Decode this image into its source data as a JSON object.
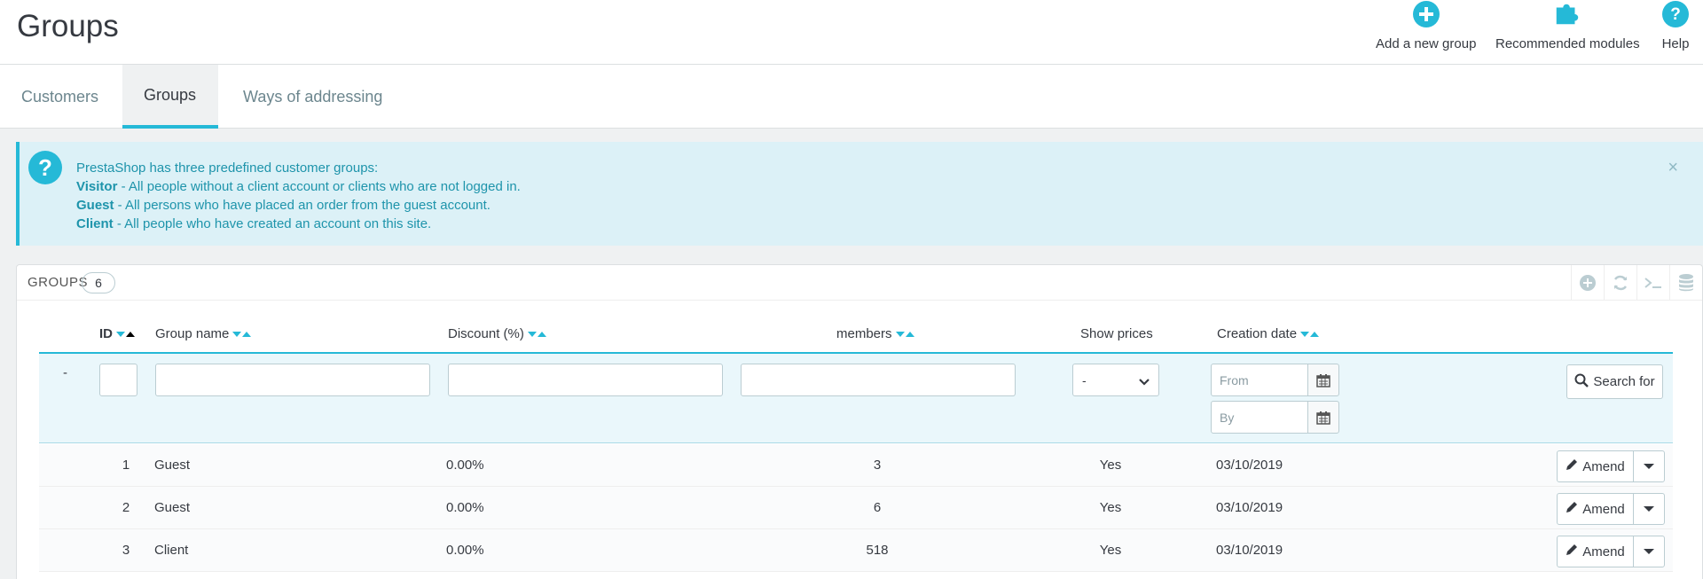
{
  "header": {
    "title": "Groups",
    "toolbar": [
      {
        "label": "Add a new group",
        "icon": "plus-circle-icon"
      },
      {
        "label": "Recommended modules",
        "icon": "puzzle-icon"
      },
      {
        "label": "Help",
        "icon": "question-circle-icon"
      }
    ]
  },
  "tabs": [
    {
      "label": "Customers",
      "active": false
    },
    {
      "label": "Groups",
      "active": true
    },
    {
      "label": "Ways of addressing",
      "active": false
    }
  ],
  "alert": {
    "intro": "PrestaShop has three predefined customer groups:",
    "lines": [
      {
        "term": "Visitor",
        "text": " - All people without a client account or clients who are not logged in."
      },
      {
        "term": "Guest",
        "text": " - All persons who have placed an order from the guest account."
      },
      {
        "term": "Client",
        "text": " - All people who have created an account on this site."
      }
    ],
    "close": "×"
  },
  "panel": {
    "title": "Groups",
    "count": "6",
    "actions": [
      "add-icon",
      "refresh-icon",
      "sql-icon",
      "database-icon"
    ]
  },
  "table": {
    "columns": {
      "id": "ID",
      "name": "Group name",
      "discount": "Discount (%)",
      "members": "members",
      "show_prices": "Show prices",
      "date": "Creation date"
    },
    "filters": {
      "dash": "-",
      "show_prices_value": "-",
      "date_from_placeholder": "From",
      "date_to_placeholder": "By",
      "search_label": "Search for"
    },
    "rows": [
      {
        "id": "1",
        "name": "Guest",
        "discount": "0.00%",
        "members": "3",
        "show_prices": "Yes",
        "date": "03/10/2019",
        "action": "Amend"
      },
      {
        "id": "2",
        "name": "Guest",
        "discount": "0.00%",
        "members": "6",
        "show_prices": "Yes",
        "date": "03/10/2019",
        "action": "Amend"
      },
      {
        "id": "3",
        "name": "Client",
        "discount": "0.00%",
        "members": "518",
        "show_prices": "Yes",
        "date": "03/10/2019",
        "action": "Amend"
      }
    ]
  },
  "colors": {
    "accent": "#25b9d7",
    "text": "#363a41",
    "alert_bg": "#dcf1f7"
  }
}
